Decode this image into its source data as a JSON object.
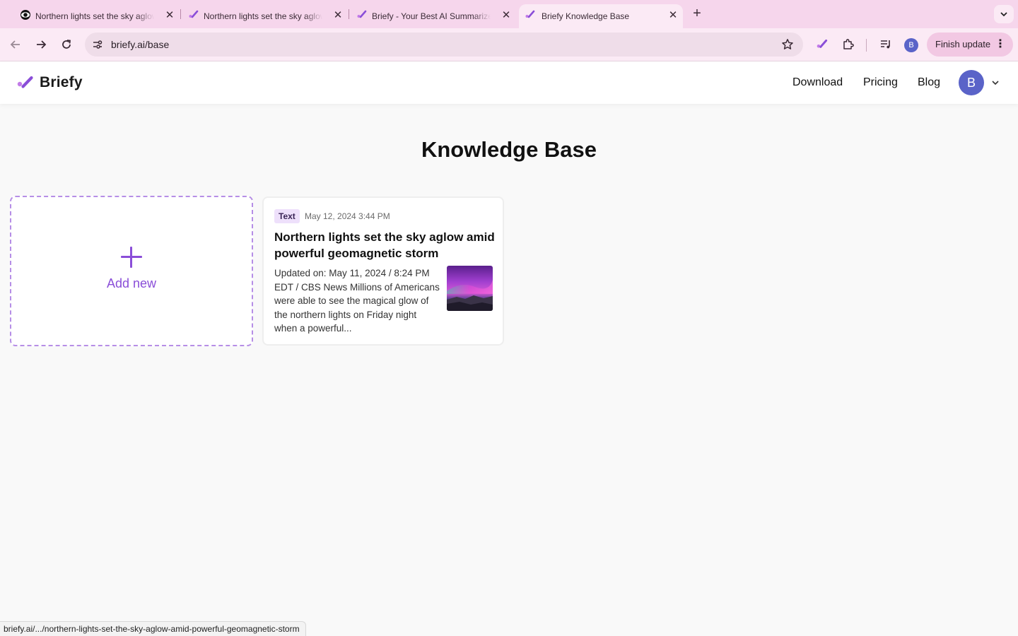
{
  "browser": {
    "tabs": [
      {
        "title": "Northern lights set the sky aglow amid powerful geomagnetic storm",
        "favicon": "cbs-eye-icon",
        "active": false
      },
      {
        "title": "Northern lights set the sky aglow amid powerful geomagnetic storm",
        "favicon": "briefy-icon",
        "active": false
      },
      {
        "title": "Briefy - Your Best AI Summarizer",
        "favicon": "briefy-icon",
        "active": false
      },
      {
        "title": "Briefy Knowledge Base",
        "favicon": "briefy-icon",
        "active": true
      }
    ],
    "url": "briefy.ai/base",
    "profile_initial": "B",
    "finish_update_label": "Finish update",
    "status_url": "briefy.ai/.../northern-lights-set-the-sky-aglow-amid-powerful-geomagnetic-storm"
  },
  "site": {
    "logo_text": "Briefy",
    "nav": {
      "download": "Download",
      "pricing": "Pricing",
      "blog": "Blog"
    },
    "avatar_initial": "B",
    "accent_color": "#8a4ed8"
  },
  "page": {
    "title": "Knowledge Base",
    "add_new_label": "Add new",
    "cards": [
      {
        "type_badge": "Text",
        "date": "May 12, 2024 3:44 PM",
        "title": "Northern lights set the sky aglow amid powerful geomagnetic storm",
        "excerpt": "Updated on: May 11, 2024 / 8:24 PM EDT / CBS News Millions of Americans were able to see the magical glow of the northern lights on Friday night when a powerful...",
        "thumbnail": "aurora-photo"
      }
    ]
  }
}
